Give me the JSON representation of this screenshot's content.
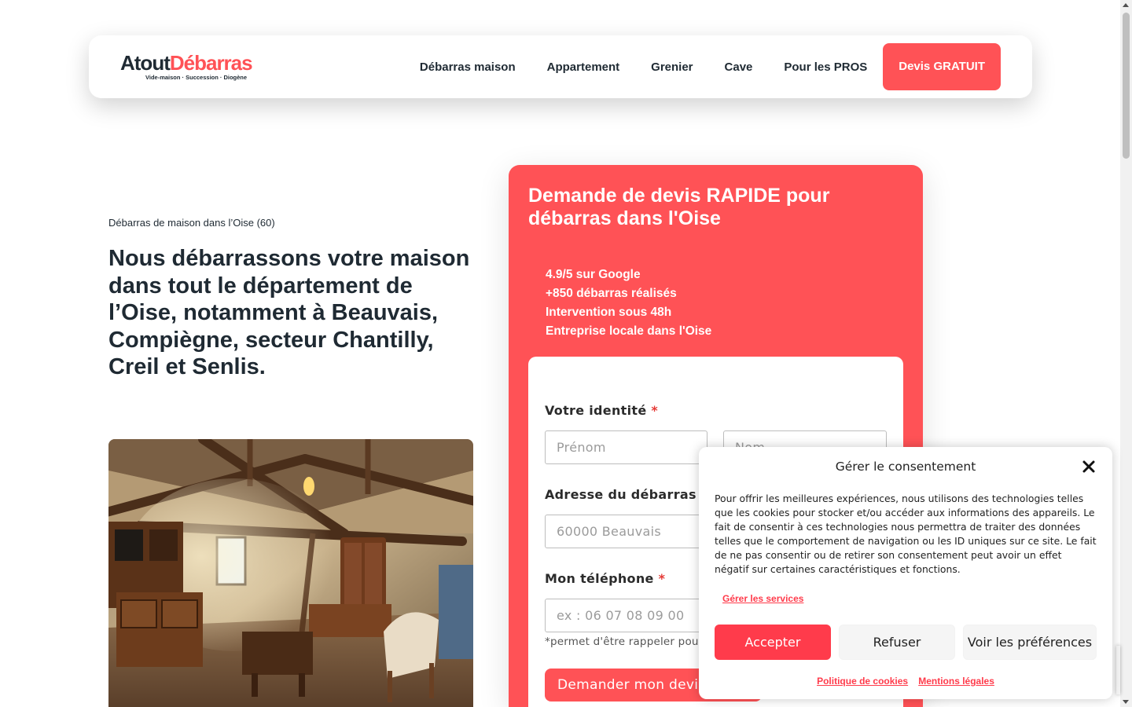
{
  "header": {
    "logo": {
      "word1": "Atout",
      "word2": "Débarras",
      "tagline": "Vide-maison · Succession · Diogène"
    },
    "nav": [
      {
        "label": "Débarras maison"
      },
      {
        "label": "Appartement"
      },
      {
        "label": "Grenier"
      },
      {
        "label": "Cave"
      },
      {
        "label": "Pour les PROS"
      }
    ],
    "cta_label": "Devis GRATUIT"
  },
  "hero": {
    "eyebrow": "Débarras de maison dans l’Oise (60)",
    "heading": "Nous débarrassons votre maison dans tout le département de l’Oise, notamment à Beauvais, Compiègne, secteur Chantilly, Creil et Senlis."
  },
  "quote_form": {
    "title": "Demande de devis RAPIDE pour débarras dans l'Oise",
    "stats": [
      "4.9/5 sur Google",
      "+850 débarras réalisés",
      "Intervention sous 48h",
      "Entreprise locale dans l'Oise"
    ],
    "identity_label": "Votre identité",
    "firstname_placeholder": "Prénom",
    "lastname_placeholder": "Nom",
    "address_label": "Adresse du débarras",
    "address_placeholder": "60000 Beauvais",
    "phone_label": "Mon téléphone",
    "phone_placeholder": "ex : 06 07 08 09 00",
    "phone_hint": "*permet d'être rappeler pour",
    "required_mark": "*",
    "submit_label": "Demander mon devis"
  },
  "consent": {
    "title": "Gérer le consentement",
    "text": "Pour offrir les meilleures expériences, nous utilisons des technologies telles que les cookies pour stocker et/ou accéder aux informations des appareils. Le fait de consentir à ces technologies nous permettra de traiter des données telles que le comportement de navigation ou les ID uniques sur ce site. Le fait de ne pas consentir ou de retirer son consentement peut avoir un effet négatif sur certaines caractéristiques et fonctions.",
    "manage_services": "Gérer les services",
    "accept": "Accepter",
    "refuse": "Refuser",
    "preferences": "Voir les préférences",
    "cookie_policy": "Politique de cookies",
    "legal": "Mentions légales"
  },
  "colors": {
    "brand": "#ff5256",
    "consent_accent": "#ff3b4b",
    "text_dark": "#1f2a33"
  }
}
